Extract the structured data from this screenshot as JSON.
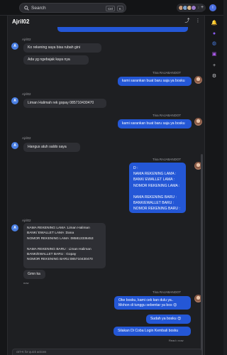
{
  "topbar": {
    "search_label": "Search",
    "kbd1": "Ctrl",
    "kbd2": "K",
    "avatar_count": "18",
    "add_label": "+",
    "profile_initial": "I",
    "accent": "#2457d6"
  },
  "chat": {
    "title": "Ajril02",
    "composer_placeholder": "ctrl+K for quick actions",
    "messages": [
      {
        "sender": "Ajril02",
        "lines": [
          "Ko rekening saya bisa rubah gini",
          "Ada yg ngebajak kaya nya"
        ]
      },
      {
        "sender": "Tina RAJABANDOT",
        "lines": [
          "kami sarankan buat baru saja ya bosku"
        ]
      },
      {
        "sender": "Ajril02",
        "lines": [
          "Liman Halimah rek gopay 085710430470"
        ]
      },
      {
        "sender": "Tina RAJABANDOT",
        "lines": [
          "kami sarankan buat baru saja ya bosku"
        ]
      },
      {
        "sender": "Ajril02",
        "lines": [
          "Hangus atuh saldo saya"
        ]
      },
      {
        "sender": "Tina RAJABANDOT",
        "lines": [
          "D :\nNAMA REKENING LAMA :\nBANK/ EWALLET LAMA :\nNOMOR REKENING LAMA :\n\nNAMA REKENING BARU :\nBANK/EWALLET BARU :\nNOMOR REKENING BARU :"
        ]
      },
      {
        "sender": "Ajril02",
        "lines": [
          "NAMA REKENING LAMA :Liman Haliman\nBANK/ EWALLET LAMA :Dana\nNOMOR REKENING LAMA :085813336453\n\nNAMA REKENING BARU : Liman Haliman\nBANK/EWALLET BARU : Gopay\nNOMOR REKENING BARU:085710430470",
          "Gmn ka"
        ],
        "time": "now"
      },
      {
        "sender": "Tina RAJABANDOT",
        "lines": [
          "Oke bosku, kami cek kan dulu ya.. \nMohon di tunggu sebentar ya bos 😊",
          "Sudah ya bosku 😊",
          "Silakan Di Coba Login Kembali bosku"
        ],
        "status": "Read • now"
      }
    ]
  }
}
